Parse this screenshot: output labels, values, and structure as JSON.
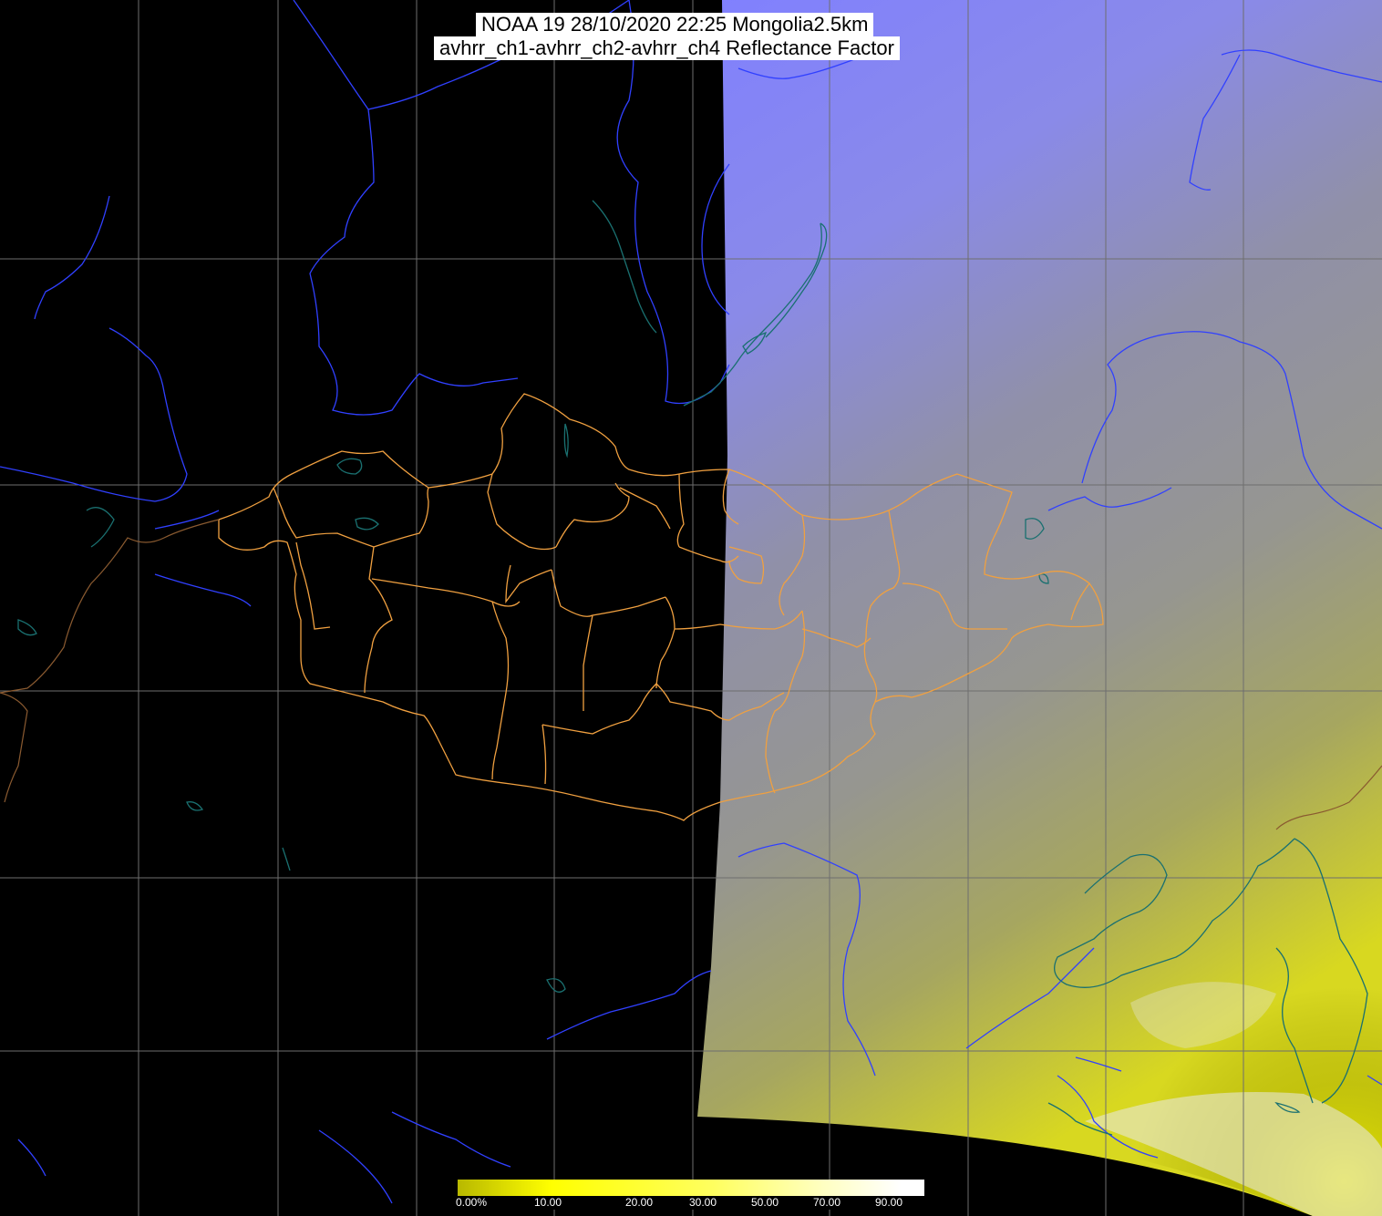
{
  "title": {
    "line1": "NOAA 19 28/10/2020 22:25 Mongolia2.5km",
    "line2": "avhrr_ch1-avhrr_ch2-avhrr_ch4 Reflectance Factor"
  },
  "colorbar": {
    "labels": [
      "0.00%",
      "10.00",
      "20.00",
      "30.00",
      "50.00",
      "70.00",
      "90.00"
    ],
    "colors": [
      "#b8b800",
      "#ffff00",
      "#ffff80",
      "#ffffff"
    ]
  },
  "colors": {
    "background": "#000000",
    "swath_top": "#8080ff",
    "swath_mid": "#8f8f9c",
    "swath_bottom": "#c8c800",
    "grid": "#6e6e6e",
    "rivers": "#3040ff",
    "coast": "#1a7070",
    "admin_borders": "#f0a040"
  },
  "icons": [
    "map-grid",
    "satellite-swath",
    "river-lines",
    "admin-boundaries",
    "colorbar"
  ]
}
